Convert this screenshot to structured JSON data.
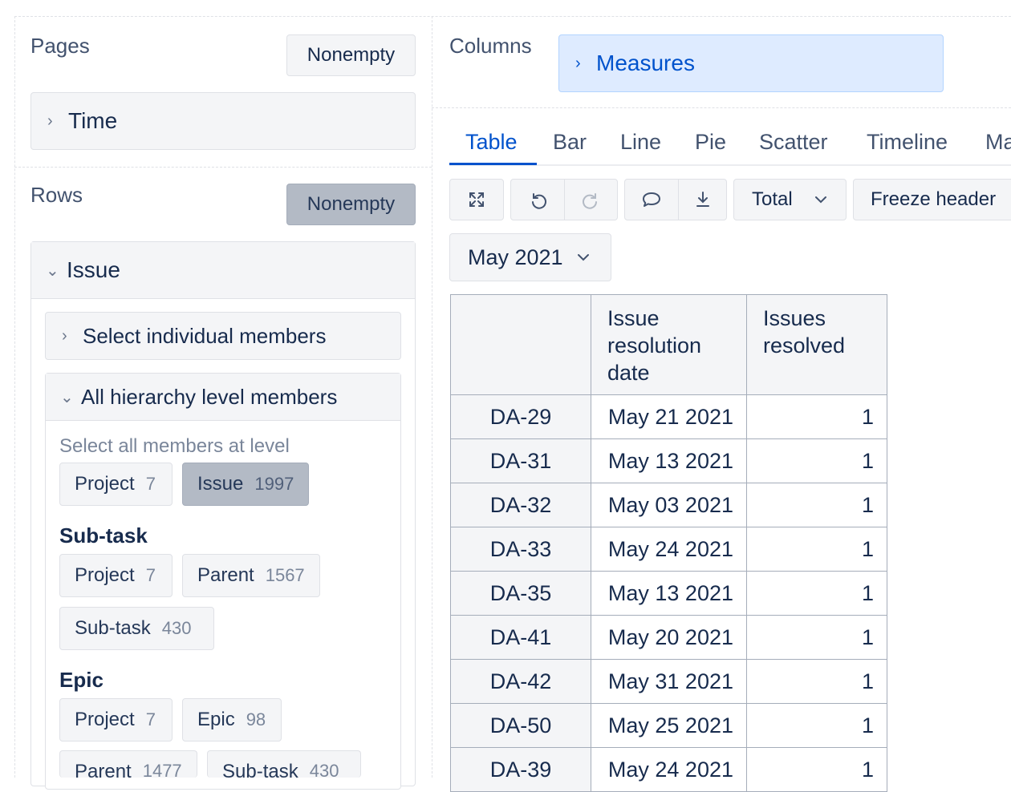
{
  "pages": {
    "title": "Pages",
    "nonempty_label": "Nonempty",
    "dimension": "Time"
  },
  "rows": {
    "title": "Rows",
    "nonempty_label": "Nonempty",
    "dimension": "Issue",
    "select_individual": "Select individual members",
    "all_hierarchy": "All hierarchy level members",
    "select_all_label": "Select all members at level",
    "default_levels": [
      {
        "name": "Project",
        "count": "7"
      },
      {
        "name": "Issue",
        "count": "1997"
      }
    ],
    "subtask_title": "Sub-task",
    "subtask_levels": [
      {
        "name": "Project",
        "count": "7"
      },
      {
        "name": "Parent",
        "count": "1567"
      },
      {
        "name": "Sub-task",
        "count": "430"
      }
    ],
    "epic_title": "Epic",
    "epic_levels": [
      {
        "name": "Project",
        "count": "7"
      },
      {
        "name": "Epic",
        "count": "98"
      },
      {
        "name": "Parent",
        "count": "1477"
      },
      {
        "name": "Sub-task",
        "count": "430"
      }
    ]
  },
  "columns": {
    "title": "Columns",
    "dimension": "Measures"
  },
  "tabs": [
    "Table",
    "Bar",
    "Line",
    "Pie",
    "Scatter",
    "Timeline",
    "Ma"
  ],
  "toolbar": {
    "total_label": "Total",
    "freeze_label": "Freeze header",
    "icons": [
      "expand-icon",
      "undo-icon",
      "redo-icon",
      "comment-icon",
      "download-icon"
    ]
  },
  "page_selector": "May 2021",
  "table": {
    "headers": [
      "",
      "Issue resolution date",
      "Issues resolved"
    ],
    "rows": [
      {
        "key": "DA-29",
        "date": "May 21 2021",
        "value": "1"
      },
      {
        "key": "DA-31",
        "date": "May 13 2021",
        "value": "1"
      },
      {
        "key": "DA-32",
        "date": "May 03 2021",
        "value": "1"
      },
      {
        "key": "DA-33",
        "date": "May 24 2021",
        "value": "1"
      },
      {
        "key": "DA-35",
        "date": "May 13 2021",
        "value": "1"
      },
      {
        "key": "DA-41",
        "date": "May 20 2021",
        "value": "1"
      },
      {
        "key": "DA-42",
        "date": "May 31 2021",
        "value": "1"
      },
      {
        "key": "DA-50",
        "date": "May 25 2021",
        "value": "1"
      },
      {
        "key": "DA-39",
        "date": "May 24 2021",
        "value": "1"
      }
    ]
  },
  "colors": {
    "accent": "#0052cc",
    "measures_bg": "#deebff",
    "active_button": "#b3bac5"
  }
}
